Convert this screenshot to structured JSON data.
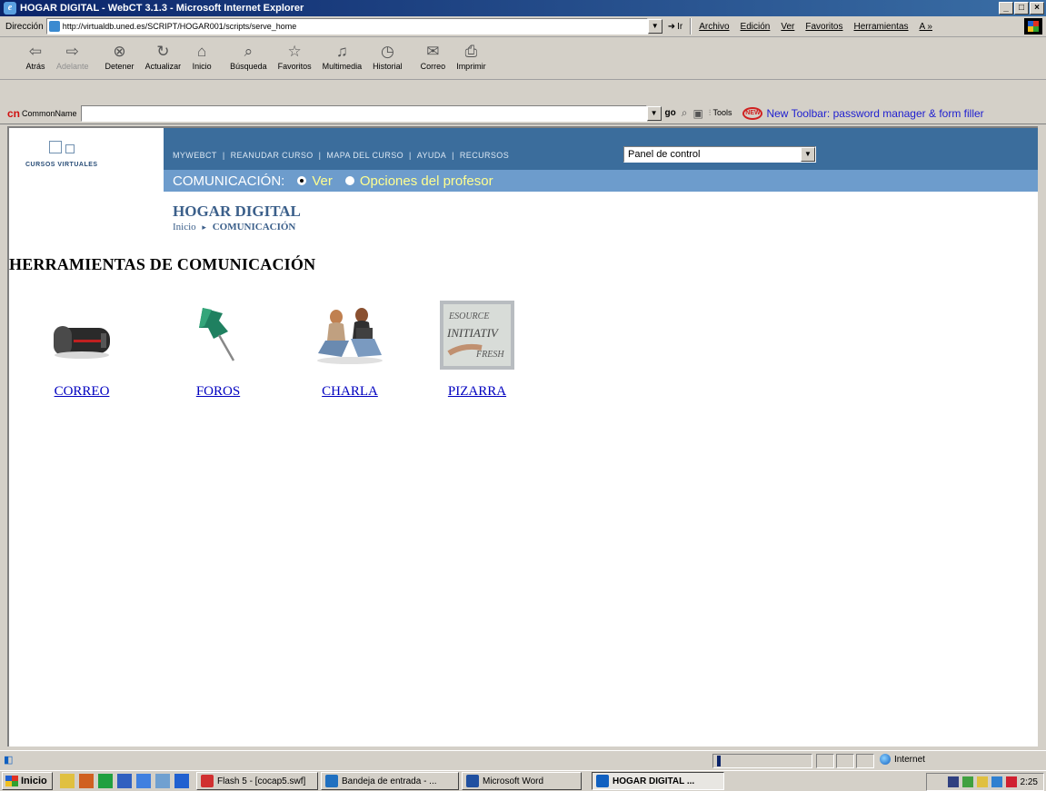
{
  "window": {
    "title": "HOGAR DIGITAL - WebCT 3.1.3 - Microsoft Internet Explorer",
    "controls": [
      "_",
      "□",
      "×"
    ]
  },
  "address_bar": {
    "label": "Dirección",
    "url": "http://virtualdb.uned.es/SCRIPT/HOGAR001/scripts/serve_home",
    "go_label": "Ir"
  },
  "menu": [
    "Archivo",
    "Edición",
    "Ver",
    "Favoritos",
    "Herramientas",
    "A »"
  ],
  "toolbar": [
    {
      "label": "Atrás",
      "icon": "⇦",
      "enabled": true
    },
    {
      "label": "Adelante",
      "icon": "⇨",
      "enabled": false
    },
    {
      "label": "Detener",
      "icon": "⊗",
      "enabled": true
    },
    {
      "label": "Actualizar",
      "icon": "↻",
      "enabled": true
    },
    {
      "label": "Inicio",
      "icon": "⌂",
      "enabled": true
    },
    {
      "label": "Búsqueda",
      "icon": "⌕",
      "enabled": true
    },
    {
      "label": "Favoritos",
      "icon": "☆",
      "enabled": true
    },
    {
      "label": "Multimedia",
      "icon": "♫",
      "enabled": true
    },
    {
      "label": "Historial",
      "icon": "◷",
      "enabled": true
    },
    {
      "label": "Correo",
      "icon": "✉",
      "enabled": true
    },
    {
      "label": "Imprimir",
      "icon": "⎙",
      "enabled": true
    }
  ],
  "commonname": {
    "logo": "cn",
    "label": "CommonName",
    "input_value": "",
    "go": "go",
    "tools": "Tools",
    "new_badge": "NEW",
    "promo": "New Toolbar: password manager & form filler"
  },
  "webct": {
    "logo_text": "CURSOS VIRTUALES",
    "nav_links": [
      "MYWEBCT",
      "REANUDAR CURSO",
      "MAPA DEL CURSO",
      "AYUDA",
      "RECURSOS"
    ],
    "panel_select": "Panel de control",
    "section": "COMUNICACIÓN:",
    "view_option": "Ver",
    "prof_option": "Opciones del profesor",
    "course_title": "HOGAR DIGITAL",
    "breadcrumb_home": "Inicio",
    "breadcrumb_sep": "▸",
    "breadcrumb_current": "COMUNICACIÓN",
    "page_heading": "HERRAMIENTAS DE COMUNICACIÓN",
    "tools": [
      {
        "label": "CORREO"
      },
      {
        "label": "FOROS"
      },
      {
        "label": "CHARLA"
      },
      {
        "label": "PIZARRA"
      }
    ]
  },
  "status": {
    "zone": "Internet"
  },
  "taskbar": {
    "start": "Inicio",
    "tasks": [
      {
        "label": "Flash 5 - [cocap5.swf]",
        "color": "#d03030"
      },
      {
        "label": "Bandeja de entrada - ...",
        "color": "#2070c0"
      },
      {
        "label": "Microsoft Word",
        "color": "#2050a0"
      },
      {
        "label": "HOGAR DIGITAL ...",
        "color": "#1060c0",
        "active": true
      }
    ],
    "clock": "2:25"
  },
  "colors": {
    "nav_dark": "#3b6d9c",
    "nav_light": "#6d9ccc",
    "title_blue": "#3b5f8a",
    "link": "#0000c0"
  }
}
